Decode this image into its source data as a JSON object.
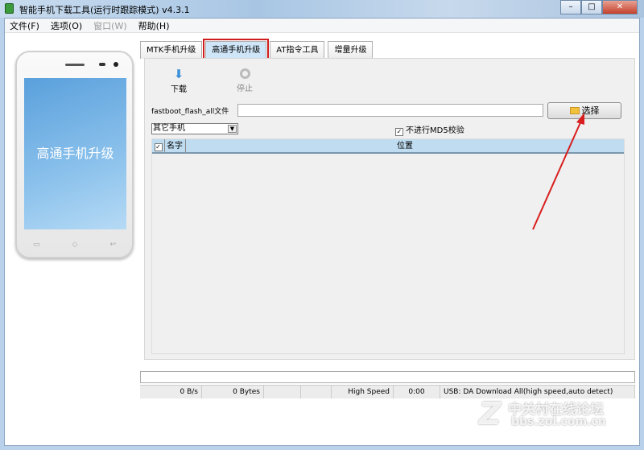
{
  "window": {
    "title": "智能手机下载工具(运行时跟踪模式)  v4.3.1",
    "min": "–",
    "max": "□",
    "close": "✕"
  },
  "menu": [
    {
      "label": "文件(F)"
    },
    {
      "label": "选项(O)"
    },
    {
      "label": "窗口(W)"
    },
    {
      "label": "帮助(H)"
    }
  ],
  "phone": {
    "screen_text": "高通手机升级",
    "keys": [
      "▭",
      "◇",
      "↩"
    ]
  },
  "tabs": [
    {
      "label": "MTK手机升级"
    },
    {
      "label": "高通手机升级"
    },
    {
      "label": "AT指令工具"
    },
    {
      "label": "增量升级"
    }
  ],
  "toolbar": {
    "download": "下载",
    "stop": "停止"
  },
  "form": {
    "file_label": "fastboot_flash_all文件",
    "file_value": "",
    "choose": "选择",
    "phone_type": "其它手机",
    "md5_label": "不进行MD5校验",
    "md5_checked": true
  },
  "table": {
    "columns": [
      "名字",
      "位置"
    ]
  },
  "status": [
    "0 B/s",
    "0 Bytes",
    "",
    "",
    "High Speed",
    "0:00",
    "USB: DA Download All(high speed,auto detect)"
  ],
  "progress": 0,
  "watermark": {
    "line1": "中关村在线论坛",
    "line2": "bbs.zol.com.cn"
  },
  "colors": {
    "active_tab": "#cfe6f8",
    "highlight": "#d01c1c",
    "header": "#bfdcf0"
  }
}
